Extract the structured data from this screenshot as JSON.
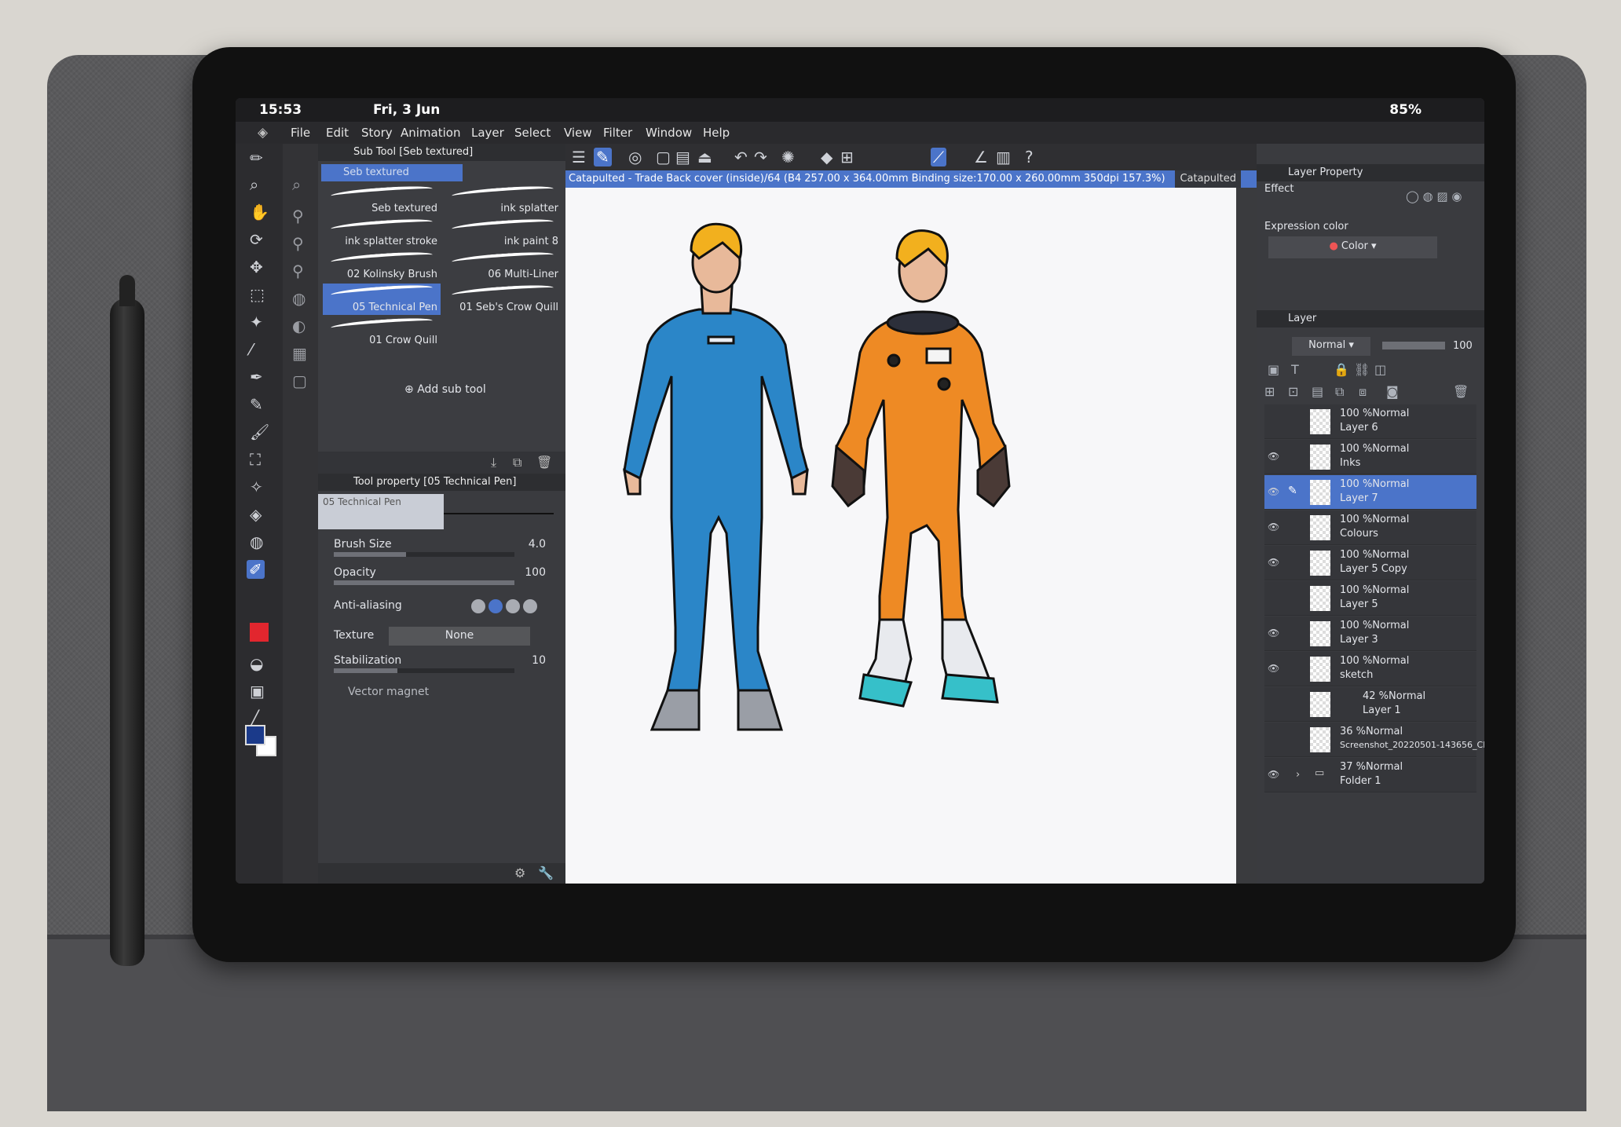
{
  "status_bar": {
    "time": "15:53",
    "date": "Fri, 3 Jun",
    "battery": "85%"
  },
  "menu": [
    "File",
    "Edit",
    "Story",
    "Animation",
    "Layer",
    "Select",
    "View",
    "Filter",
    "Window",
    "Help"
  ],
  "document": {
    "title": "Catapulted - Trade Back cover (inside)/64 (B4 257.00 x 364.00mm Binding size:170.00 x 260.00mm 350dpi 157.3%)",
    "second_tab": "Catapulted"
  },
  "sub_tool_panel": {
    "header": "Sub Tool [Seb textured]",
    "group": "Seb textured",
    "brushes": [
      {
        "label": "Seb textured"
      },
      {
        "label": "ink splatter"
      },
      {
        "label": "ink splatter stroke"
      },
      {
        "label": "ink paint 8"
      },
      {
        "label": "02 Kolinsky Brush"
      },
      {
        "label": "06 Multi-Liner"
      },
      {
        "label": "05 Technical Pen"
      },
      {
        "label": "01 Seb's Crow Quill"
      },
      {
        "label": "01 Crow Quill"
      }
    ],
    "add_sub_tool": "Add sub tool"
  },
  "tool_property": {
    "header": "Tool property [05 Technical Pen]",
    "preview_label": "05 Technical Pen",
    "brush_size_label": "Brush Size",
    "brush_size": "4.0",
    "brush_size_fraction": 0.4,
    "opacity_label": "Opacity",
    "opacity": "100",
    "opacity_fraction": 1.0,
    "anti_aliasing_label": "Anti-aliasing",
    "texture_label": "Texture",
    "texture_value": "None",
    "stabilization_label": "Stabilization",
    "stabilization": "10",
    "stabilization_fraction": 0.35,
    "vector_magnet": "Vector magnet"
  },
  "layer_property": {
    "header": "Layer Property",
    "effect_label": "Effect",
    "expression_color_label": "Expression color",
    "expression_color_value": "Color"
  },
  "layer_panel": {
    "header": "Layer",
    "blend_mode": "Normal",
    "opacity": "100",
    "layers": [
      {
        "blend": "100 %Normal",
        "name": "Layer 6",
        "visible": false,
        "selected": false
      },
      {
        "blend": "100 %Normal",
        "name": "Inks",
        "visible": true,
        "selected": false
      },
      {
        "blend": "100 %Normal",
        "name": "Layer 7",
        "visible": true,
        "selected": true
      },
      {
        "blend": "100 %Normal",
        "name": "Colours",
        "visible": true,
        "selected": false
      },
      {
        "blend": "100 %Normal",
        "name": "Layer 5 Copy",
        "visible": true,
        "selected": false
      },
      {
        "blend": "100 %Normal",
        "name": "Layer 5",
        "visible": false,
        "selected": false
      },
      {
        "blend": "100 %Normal",
        "name": "Layer 3",
        "visible": true,
        "selected": false
      },
      {
        "blend": "100 %Normal",
        "name": "sketch",
        "visible": true,
        "selected": false
      },
      {
        "blend": "42 %Normal",
        "name": "Layer 1",
        "visible": false,
        "selected": false
      },
      {
        "blend": "36 %Normal",
        "name": "Screenshot_20220501-143656_Cl...",
        "visible": false,
        "selected": false
      },
      {
        "blend": "37 %Normal",
        "name": "Folder 1",
        "visible": true,
        "selected": false
      }
    ]
  },
  "colors": {
    "accent": "#4b74c9",
    "suit_blue": "#2b86c8",
    "suit_orange": "#ee8a24",
    "foreground": "#1b3a8a",
    "red_swatch": "#e2262e"
  }
}
